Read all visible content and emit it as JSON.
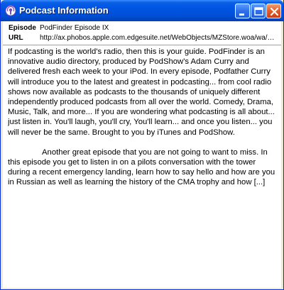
{
  "window": {
    "title": "Podcast Information",
    "icon": "podcast-icon",
    "buttons": [
      "minimize-icon",
      "maximize-icon",
      "close-icon"
    ],
    "colors": {
      "titlebar": "#0054e3",
      "close_button": "#e0602f",
      "frame": "#ece9d8"
    }
  },
  "metadata": {
    "episode_label": "Episode",
    "episode_value": "PodFinder Episode IX",
    "url_label": "URL",
    "url_value": "http://ax.phobos.apple.com.edgesuite.net/WebObjects/MZStore.woa/wa/podc..."
  },
  "description": {
    "paragraph1": "If podcasting is the world's radio, then this is your guide. PodFinder is an innovative audio directory, produced by PodShow's Adam Curry and delivered fresh each week to your iPod.  In every episode, Podfather Curry will introduce you to the latest and greatest in podcasting...  from cool radio shows now available as podcasts to the thousands of uniquely different independently produced podcasts from all over the world. Comedy, Drama, Music, Talk, and more...  If you are wondering what podcasting is all about... just listen in. You'll laugh, you'll cry, You'll learn... and once you listen... you will never be the same.  Brought to you by iTunes and  PodShow.",
    "paragraph2": "Another great episode that you are not going to want to miss. In this episode you get to listen in on a pilots conversation with the tower during a recent emergency landing, learn how to say hello and how are you in Russian as well as learning the history of the CMA trophy and how [...]"
  }
}
